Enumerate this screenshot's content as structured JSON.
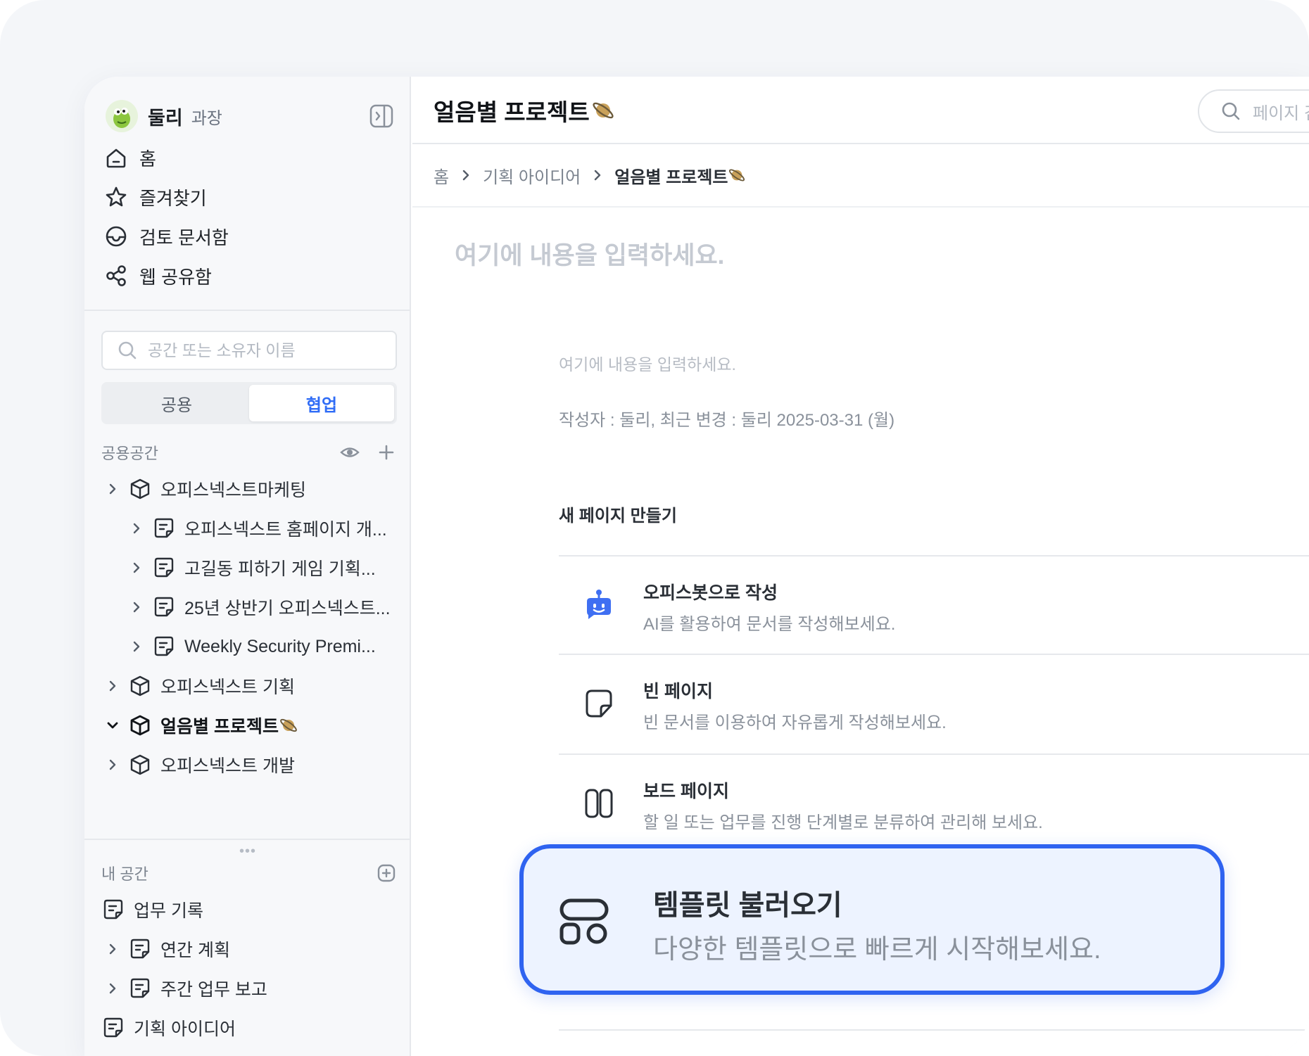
{
  "user": {
    "name": "둘리",
    "role": "과장"
  },
  "nav": [
    {
      "label": "홈",
      "icon": "home-icon"
    },
    {
      "label": "즐겨찾기",
      "icon": "star-icon"
    },
    {
      "label": "검토 문서함",
      "icon": "inbox-icon"
    },
    {
      "label": "웹 공유함",
      "icon": "share-icon"
    }
  ],
  "sidebar_search": {
    "placeholder": "공간 또는 소유자 이름"
  },
  "space_tabs": [
    {
      "label": "공용",
      "selected": false
    },
    {
      "label": "협업",
      "selected": true
    }
  ],
  "shared_space": {
    "heading": "공용공간",
    "items": [
      {
        "label": "오피스넥스트마케팅",
        "icon": "cube-icon",
        "expanded": false,
        "level": 0
      },
      {
        "label": "오피스넥스트 홈페이지 개...",
        "icon": "page-icon",
        "expanded": false,
        "level": 1
      },
      {
        "label": "고길동 피하기 게임 기획...",
        "icon": "page-icon",
        "expanded": false,
        "level": 1
      },
      {
        "label": "25년 상반기 오피스넥스트...",
        "icon": "page-icon",
        "expanded": false,
        "level": 1
      },
      {
        "label": "Weekly Security Premi...",
        "icon": "page-icon",
        "expanded": false,
        "level": 1
      },
      {
        "label": "오피스넥스트 기획",
        "icon": "cube-icon",
        "expanded": false,
        "level": 0
      },
      {
        "label": "얼음별 프로젝트",
        "icon": "cube-icon",
        "expanded": true,
        "level": 0,
        "active": true
      },
      {
        "label": "오피스넥스트 개발",
        "icon": "cube-icon",
        "expanded": false,
        "level": 0
      }
    ]
  },
  "my_space": {
    "heading": "내 공간",
    "items": [
      {
        "label": "업무 기록",
        "icon": "page-icon",
        "has_children": false
      },
      {
        "label": "연간 계획",
        "icon": "page-icon",
        "has_children": true
      },
      {
        "label": "주간 업무 보고",
        "icon": "page-icon",
        "has_children": true
      },
      {
        "label": "기획 아이디어",
        "icon": "page-icon",
        "has_children": false
      }
    ]
  },
  "page": {
    "title": "얼음별 프로젝트",
    "search_placeholder": "페이지 검",
    "breadcrumb": [
      "홈",
      "기획 아이디어",
      "얼음별 프로젝트"
    ],
    "main_placeholder": "여기에 내용을 입력하세요.",
    "sub_placeholder": "여기에 내용을 입력하세요.",
    "meta": "작성자 : 둘리,  최근 변경 : 둘리  2025-03-31 (월)",
    "new_page_title": "새 페이지 만들기",
    "options": [
      {
        "title": "오피스봇으로 작성",
        "desc": "AI를 활용하여 문서를 작성해보세요.",
        "icon": "bot-icon"
      },
      {
        "title": "빈 페이지",
        "desc": "빈 문서를 이용하여 자유롭게 작성해보세요.",
        "icon": "blank-page-icon"
      },
      {
        "title": "보드 페이지",
        "desc": "할 일 또는 업무를 진행 단계별로 분류하여 관리해 보세요.",
        "icon": "board-icon"
      }
    ],
    "highlight": {
      "title": "템플릿 불러오기",
      "desc": "다양한 템플릿으로 빠르게 시작해보세요.",
      "icon": "template-icon"
    }
  },
  "colors": {
    "accent": "#2f63f0",
    "highlight_bg": "#edf3ff",
    "bot_blue": "#3f6ff2"
  }
}
